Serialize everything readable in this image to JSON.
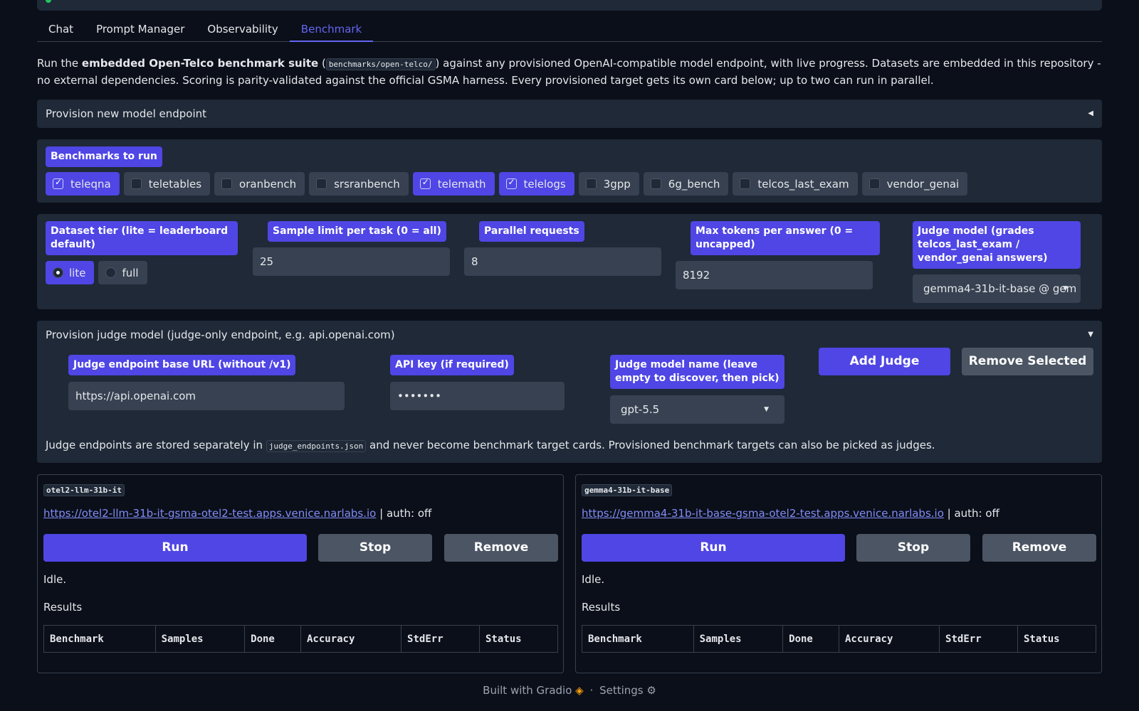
{
  "tabs": [
    {
      "label": "Chat"
    },
    {
      "label": "Prompt Manager"
    },
    {
      "label": "Observability"
    },
    {
      "label": "Benchmark"
    }
  ],
  "intro": {
    "p1": "Run the ",
    "bold": "embedded Open-Telco benchmark suite",
    "p2": " (",
    "code": "benchmarks/open-telco/",
    "p3": ") against any provisioned OpenAI-compatible model endpoint, with live progress. Datasets are embedded in this repository - no external dependencies. Scoring is parity-validated against the official GSMA harness. Every provisioned target gets its own card below; up to two can run in parallel."
  },
  "provision": {
    "label": "Provision new model endpoint",
    "caret": "◀"
  },
  "benchmarks": {
    "label": "Benchmarks to run",
    "items": [
      {
        "label": "teleqna",
        "checked": true
      },
      {
        "label": "teletables",
        "checked": false
      },
      {
        "label": "oranbench",
        "checked": false
      },
      {
        "label": "srsranbench",
        "checked": false
      },
      {
        "label": "telemath",
        "checked": true
      },
      {
        "label": "telelogs",
        "checked": true
      },
      {
        "label": "3gpp",
        "checked": false
      },
      {
        "label": "6g_bench",
        "checked": false
      },
      {
        "label": "telcos_last_exam",
        "checked": false
      },
      {
        "label": "vendor_genai",
        "checked": false
      }
    ]
  },
  "settings": {
    "tier_label": "Dataset tier (lite = leaderboard default)",
    "tier_lite": "lite",
    "tier_full": "full",
    "sample_label": "Sample limit per task (0 = all)",
    "sample_value": "25",
    "parallel_label": "Parallel requests",
    "parallel_value": "8",
    "max_tokens_label": "Max tokens per answer (0 = uncapped)",
    "max_tokens_value": "8192",
    "judge_label": "Judge model (grades telcos_last_exam / vendor_genai answers)",
    "judge_value": "gemma4-31b-it-base @ gem"
  },
  "judge": {
    "header": "Provision judge model (judge-only endpoint, e.g. api.openai.com)",
    "caret": "▼",
    "url_label": "Judge endpoint base URL (without /v1)",
    "url_value": "https://api.openai.com",
    "key_label": "API key (if required)",
    "key_value": "•••••••",
    "name_label": "Judge model name (leave empty to discover, then pick)",
    "name_value": "gpt-5.5",
    "add_label": "Add Judge",
    "remove_label": "Remove Selected",
    "note_p1": "Judge endpoints are stored separately in ",
    "note_code": "judge_endpoints.json",
    "note_p2": " and never become benchmark target cards. Provisioned benchmark targets can also be picked as judges."
  },
  "cards": [
    {
      "tag": "otel2-llm-31b-it",
      "url": "https://otel2-llm-31b-it-gsma-otel2-test.apps.venice.narlabs.io",
      "auth": " | auth: off",
      "run": "Run",
      "stop": "Stop",
      "remove": "Remove",
      "status": "Idle.",
      "results": "Results"
    },
    {
      "tag": "gemma4-31b-it-base",
      "url": "https://gemma4-31b-it-base-gsma-otel2-test.apps.venice.narlabs.io",
      "auth": " | auth: off",
      "run": "Run",
      "stop": "Stop",
      "remove": "Remove",
      "status": "Idle.",
      "results": "Results"
    }
  ],
  "table_headers": [
    "Benchmark",
    "Samples",
    "Done",
    "Accuracy",
    "StdErr",
    "Status"
  ],
  "footer": {
    "built": "Built with Gradio",
    "sep": "·",
    "settings": "Settings"
  }
}
